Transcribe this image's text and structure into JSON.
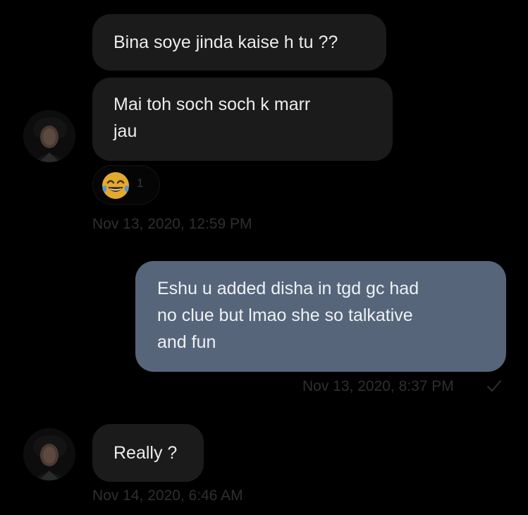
{
  "thread": {
    "messages": [
      {
        "sender": "other",
        "text": "Bina soye jinda kaise h tu ??"
      },
      {
        "sender": "other",
        "lines": [
          "Mai toh soch soch k marr",
          "jau"
        ]
      },
      {
        "sender": "me",
        "lines": [
          "Eshu u added disha in tgd gc had",
          "no clue but lmao she so talkative",
          "and fun"
        ]
      },
      {
        "sender": "other",
        "text": "Really ?"
      }
    ],
    "reaction": {
      "emoji": "laughing-tears-emoji",
      "count": "1"
    },
    "timestamps": {
      "first": "Nov 13, 2020, 12:59 PM",
      "second": "Nov 13, 2020, 8:37 PM",
      "third": "Nov 14, 2020, 6:46 AM"
    },
    "status_icon": "checkmark-icon"
  },
  "colors": {
    "background": "#000000",
    "received_bubble": "#1b1b1b",
    "sent_bubble": "#56657a",
    "timestamp_text": "#2f2f2f"
  }
}
